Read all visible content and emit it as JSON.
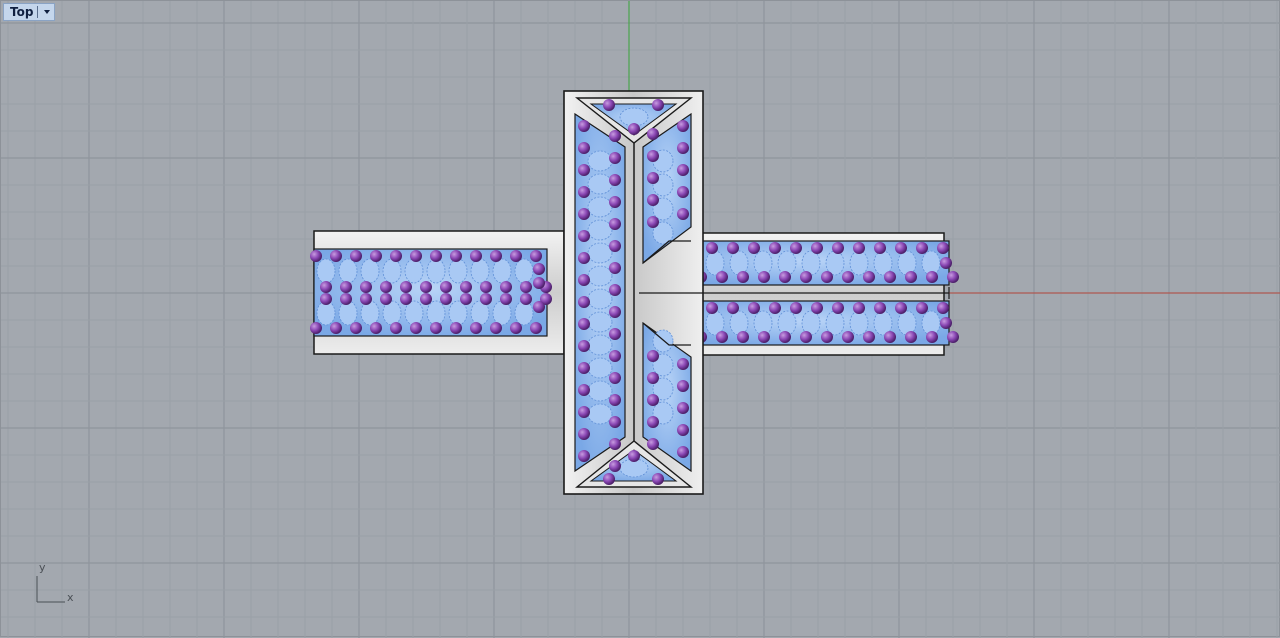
{
  "viewport": {
    "name": "Top",
    "background": "#a3a8af",
    "grid_minor_color": "#9aa0a7",
    "grid_major_color": "#8f959c",
    "x_axis_color": "#b5483e",
    "y_axis_color": "#3ca83c"
  },
  "axis_icon": {
    "y_label": "y",
    "x_label": "x"
  },
  "model": {
    "metal_color": "#d9d9d9",
    "stone_color": "#8fb8f0",
    "prong_color": "#7b3fa0"
  }
}
